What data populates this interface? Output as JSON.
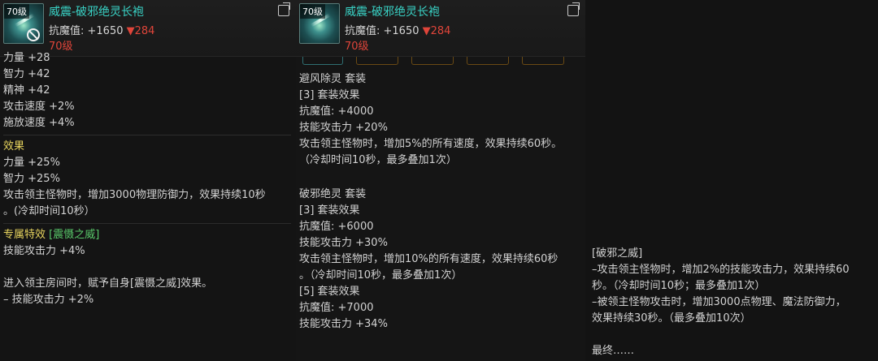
{
  "item": {
    "level_badge": "70级",
    "name": "威震-破邪绝灵长袍",
    "resist_label": "抗魔值: +1650",
    "resist_down": "▼284",
    "level_text": "70级"
  },
  "panel1": {
    "stats": [
      "力量 +28",
      "智力 +42",
      "精神 +42",
      "攻击速度 +2%",
      "施放速度 +4%"
    ],
    "effect_title": "效果",
    "effects": [
      "力量 +25%",
      "智力 +25%",
      "攻击领主怪物时，增加3000物理防御力，效果持续10秒",
      "。(冷却时间10秒）"
    ],
    "exclusive_title": "专属特效",
    "exclusive_name": "[震慑之威]",
    "exclusive_lines": [
      "技能攻击力 +4%",
      "",
      "进入领主房间时，赋予自身[震慑之威]效果。",
      "– 技能攻击力 +2%"
    ]
  },
  "panel2": {
    "lines": [
      "避风除灵 套装",
      "[3] 套装效果",
      "抗魔值: +4000",
      "技能攻击力 +20%",
      "攻击领主怪物时，增加5%的所有速度，效果持续60秒。",
      "（冷却时间10秒，最多叠加1次）",
      "",
      "破邪绝灵 套装",
      "[3] 套装效果",
      "抗魔值: +6000",
      "技能攻击力 +30%",
      "攻击领主怪物时，增加10%的所有速度，效果持续60秒",
      "。（冷却时间10秒，最多叠加1次）",
      "[5] 套装效果",
      "抗魔值: +7000",
      "技能攻击力 +34%"
    ]
  },
  "panel3": {
    "lines": [
      "[破邪之威]",
      "–攻击领主怪物时，增加2%的技能攻击力，效果持续60",
      "秒。（冷却时间10秒；最多叠加1次）",
      "–被领主怪物攻击时，增加3000点物理、魔法防御力，",
      "效果持续30秒。（最多叠加10次）",
      "",
      "最终……"
    ]
  },
  "icons": [
    "ban-icon",
    "share-icon"
  ],
  "colors": {
    "title": "#39d3c6",
    "down": "#e0453a",
    "effect_header": "#e7d45e",
    "exclusive_name": "#59c96a"
  }
}
